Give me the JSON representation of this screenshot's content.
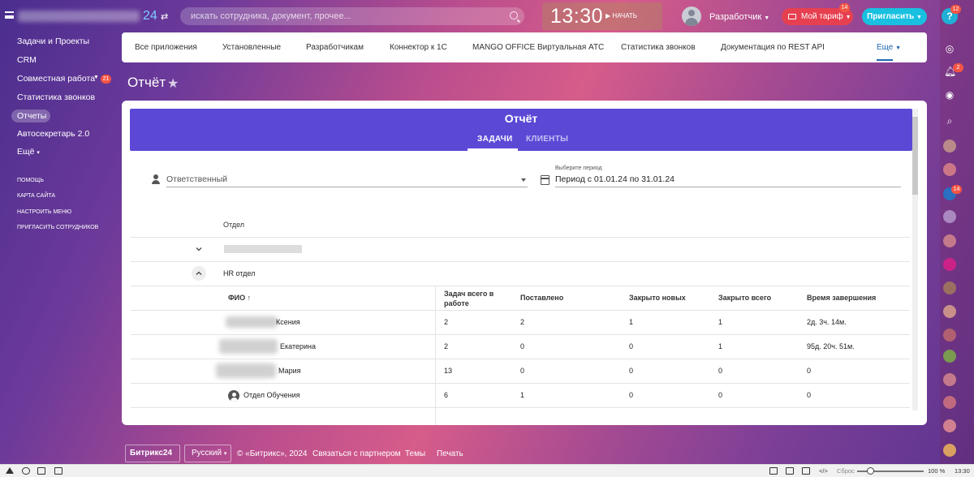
{
  "topbar": {
    "logo_suffix": "24",
    "search_placeholder": "искать сотрудника, документ, прочее...",
    "clock": "13:30",
    "start_label": "НАЧАТЬ",
    "user_name": "Разработчик",
    "tariff_label": "Мой тариф",
    "tariff_badge": "14",
    "invite_label": "Пригласить",
    "help_badge": "12"
  },
  "sidebar": {
    "items": [
      {
        "label": "Задачи и Проекты"
      },
      {
        "label": "CRM"
      },
      {
        "label": "Совместная работа",
        "badge": "21"
      },
      {
        "label": "Статистика звонков"
      },
      {
        "label": "Отчеты",
        "active": true
      },
      {
        "label": "Автосекретарь 2.0"
      },
      {
        "label": "Ещё"
      }
    ],
    "links": [
      "ПОМОЩЬ",
      "КАРТА САЙТА",
      "НАСТРОИТЬ МЕНЮ",
      "ПРИГЛАСИТЬ СОТРУДНИКОВ"
    ]
  },
  "nav": {
    "items": [
      "Все приложения",
      "Установленные",
      "Разработчикам",
      "Коннектор к 1С",
      "MANGO OFFICE Виртуальная АТС",
      "Статистика звонков",
      "Документация по REST API"
    ],
    "more": "Еще"
  },
  "page": {
    "title": "Отчёт"
  },
  "report": {
    "title": "Отчёт",
    "tabs": [
      "ЗАДАЧИ",
      "КЛИЕНТЫ"
    ],
    "responsible_label": "Ответственный",
    "period_label": "Выберите период",
    "period_value": "Период с 01.01.24 по 31.01.24",
    "dept_header": "Отдел",
    "dept_name": "HR отдел",
    "columns": [
      "ФИО",
      "Задач всего в работе",
      "Поставлено",
      "Закрыто новых",
      "Закрыто всего",
      "Время завершения"
    ],
    "rows": [
      {
        "name": "Ксения",
        "total": "2",
        "set": "2",
        "closed_new": "1",
        "closed_all": "1",
        "time": "2д. 3ч. 14м."
      },
      {
        "name": "Екатерина",
        "total": "2",
        "set": "0",
        "closed_new": "0",
        "closed_all": "1",
        "time": "95д. 20ч. 51м."
      },
      {
        "name": "Мария",
        "total": "13",
        "set": "0",
        "closed_new": "0",
        "closed_all": "0",
        "time": "0"
      },
      {
        "name": "Отдел Обучения",
        "total": "6",
        "set": "1",
        "closed_new": "0",
        "closed_all": "0",
        "time": "0"
      }
    ]
  },
  "footer": {
    "logo": "Битрикс24",
    "lang": "Русский",
    "copyright": "© «Битрикс», 2024",
    "partner": "Связаться с партнером",
    "themes": "Темы",
    "print": "Печать"
  },
  "right_badges": {
    "notifications": "2",
    "chat": "14"
  },
  "taskbar": {
    "reset": "Сброс",
    "zoom": "100 %",
    "time": "13:30"
  }
}
